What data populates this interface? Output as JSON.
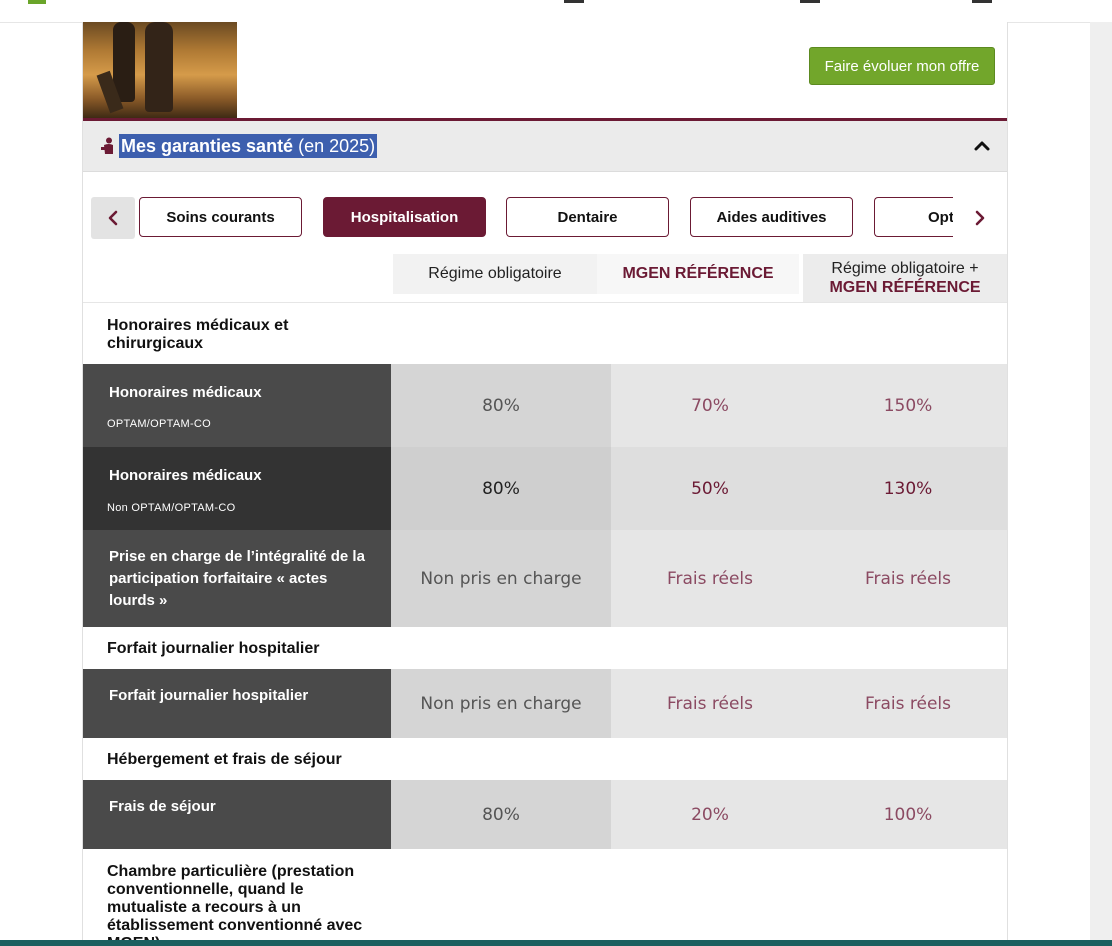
{
  "header": {
    "upgrade_label": "Faire évoluer mon offre"
  },
  "section": {
    "title_bold": "Mes garanties santé",
    "title_year": "(en 2025)"
  },
  "tabs": [
    {
      "label": "Soins courants",
      "active": false
    },
    {
      "label": "Hospitalisation",
      "active": true
    },
    {
      "label": "Dentaire",
      "active": false
    },
    {
      "label": "Aides auditives",
      "active": false
    },
    {
      "label": "Opt",
      "active": false
    }
  ],
  "columns": {
    "c1": "Régime obligatoire",
    "c2": "MGEN RÉFÉRENCE",
    "c3_line1": "Régime obligatoire +",
    "c3_line2": "MGEN RÉFÉRENCE"
  },
  "groups": {
    "g1": "Honoraires médicaux et chirurgicaux",
    "g2": "Forfait journalier hospitalier",
    "g3": "Hébergement et frais de séjour",
    "g4": "Chambre particulière (prestation conventionnelle, quand le mutualiste a recours à un établissement conventionné avec MGEN)"
  },
  "rows": [
    {
      "label": "Honoraires médicaux",
      "sub": "OPTAM/OPTAM-CO",
      "v1": "80%",
      "v2": "70%",
      "v3": "150%"
    },
    {
      "label": "Honoraires médicaux",
      "sub": "Non OPTAM/OPTAM-CO",
      "v1": "80%",
      "v2": "50%",
      "v3": "130%"
    },
    {
      "label": "Prise en charge de l’intégralité de la participation forfaitaire « actes lourds »",
      "v1": "Non pris en charge",
      "v2": "Frais réels",
      "v3": "Frais réels"
    },
    {
      "label": "Forfait journalier hospitalier",
      "v1": "Non pris en charge",
      "v2": "Frais réels",
      "v3": "Frais réels"
    },
    {
      "label": "Frais de séjour",
      "v1": "80%",
      "v2": "20%",
      "v3": "100%"
    }
  ],
  "icons": {
    "section": "person-care-icon",
    "collapse": "chevron-up-icon",
    "prev": "chevron-left-icon",
    "next": "chevron-right-icon"
  },
  "colors": {
    "brand": "#6b1a34",
    "accent_green": "#72a62b",
    "selection": "#3d5fae"
  }
}
